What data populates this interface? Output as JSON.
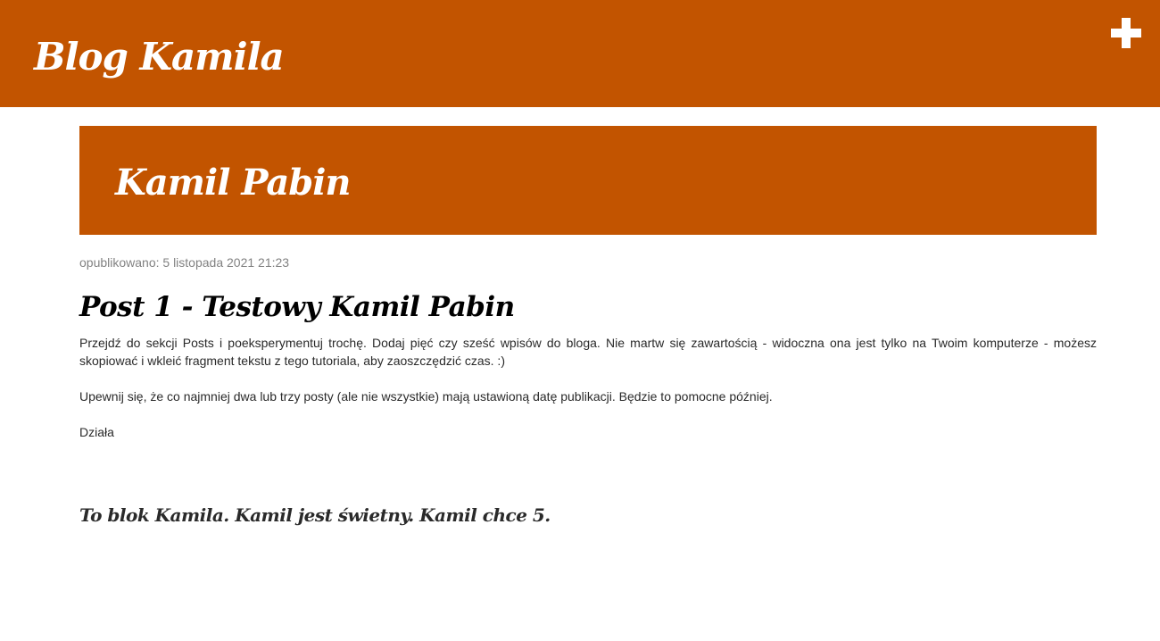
{
  "header": {
    "site_title": "Blog Kamila",
    "add_button_icon": "plus-icon"
  },
  "banner": {
    "title": "Kamil Pabin"
  },
  "post": {
    "published": "opublikowano: 5 listopada 2021 21:23",
    "title": "Post 1 - Testowy Kamil Pabin",
    "paragraphs": [
      "Przejdź do sekcji Posts i poeksperymentuj trochę. Dodaj pięć czy sześć wpisów do bloga. Nie martw się zawartością - widoczna ona jest tylko na Twoim komputerze - możesz skopiować i wkleić fragment tekstu z tego tutoriala, aby zaoszczędzić czas. :)",
      "Upewnij się, że co najmniej dwa lub trzy posty (ale nie wszystkie) mają ustawioną datę publikacji. Będzie to pomocne później.",
      "Działa"
    ]
  },
  "footer": {
    "note": "To blok Kamila. Kamil jest świetny. Kamil chce 5."
  },
  "colors": {
    "accent": "#c25400",
    "header_text": "#ffffff",
    "meta_text": "#828282",
    "body_text": "#2a2a2a"
  }
}
